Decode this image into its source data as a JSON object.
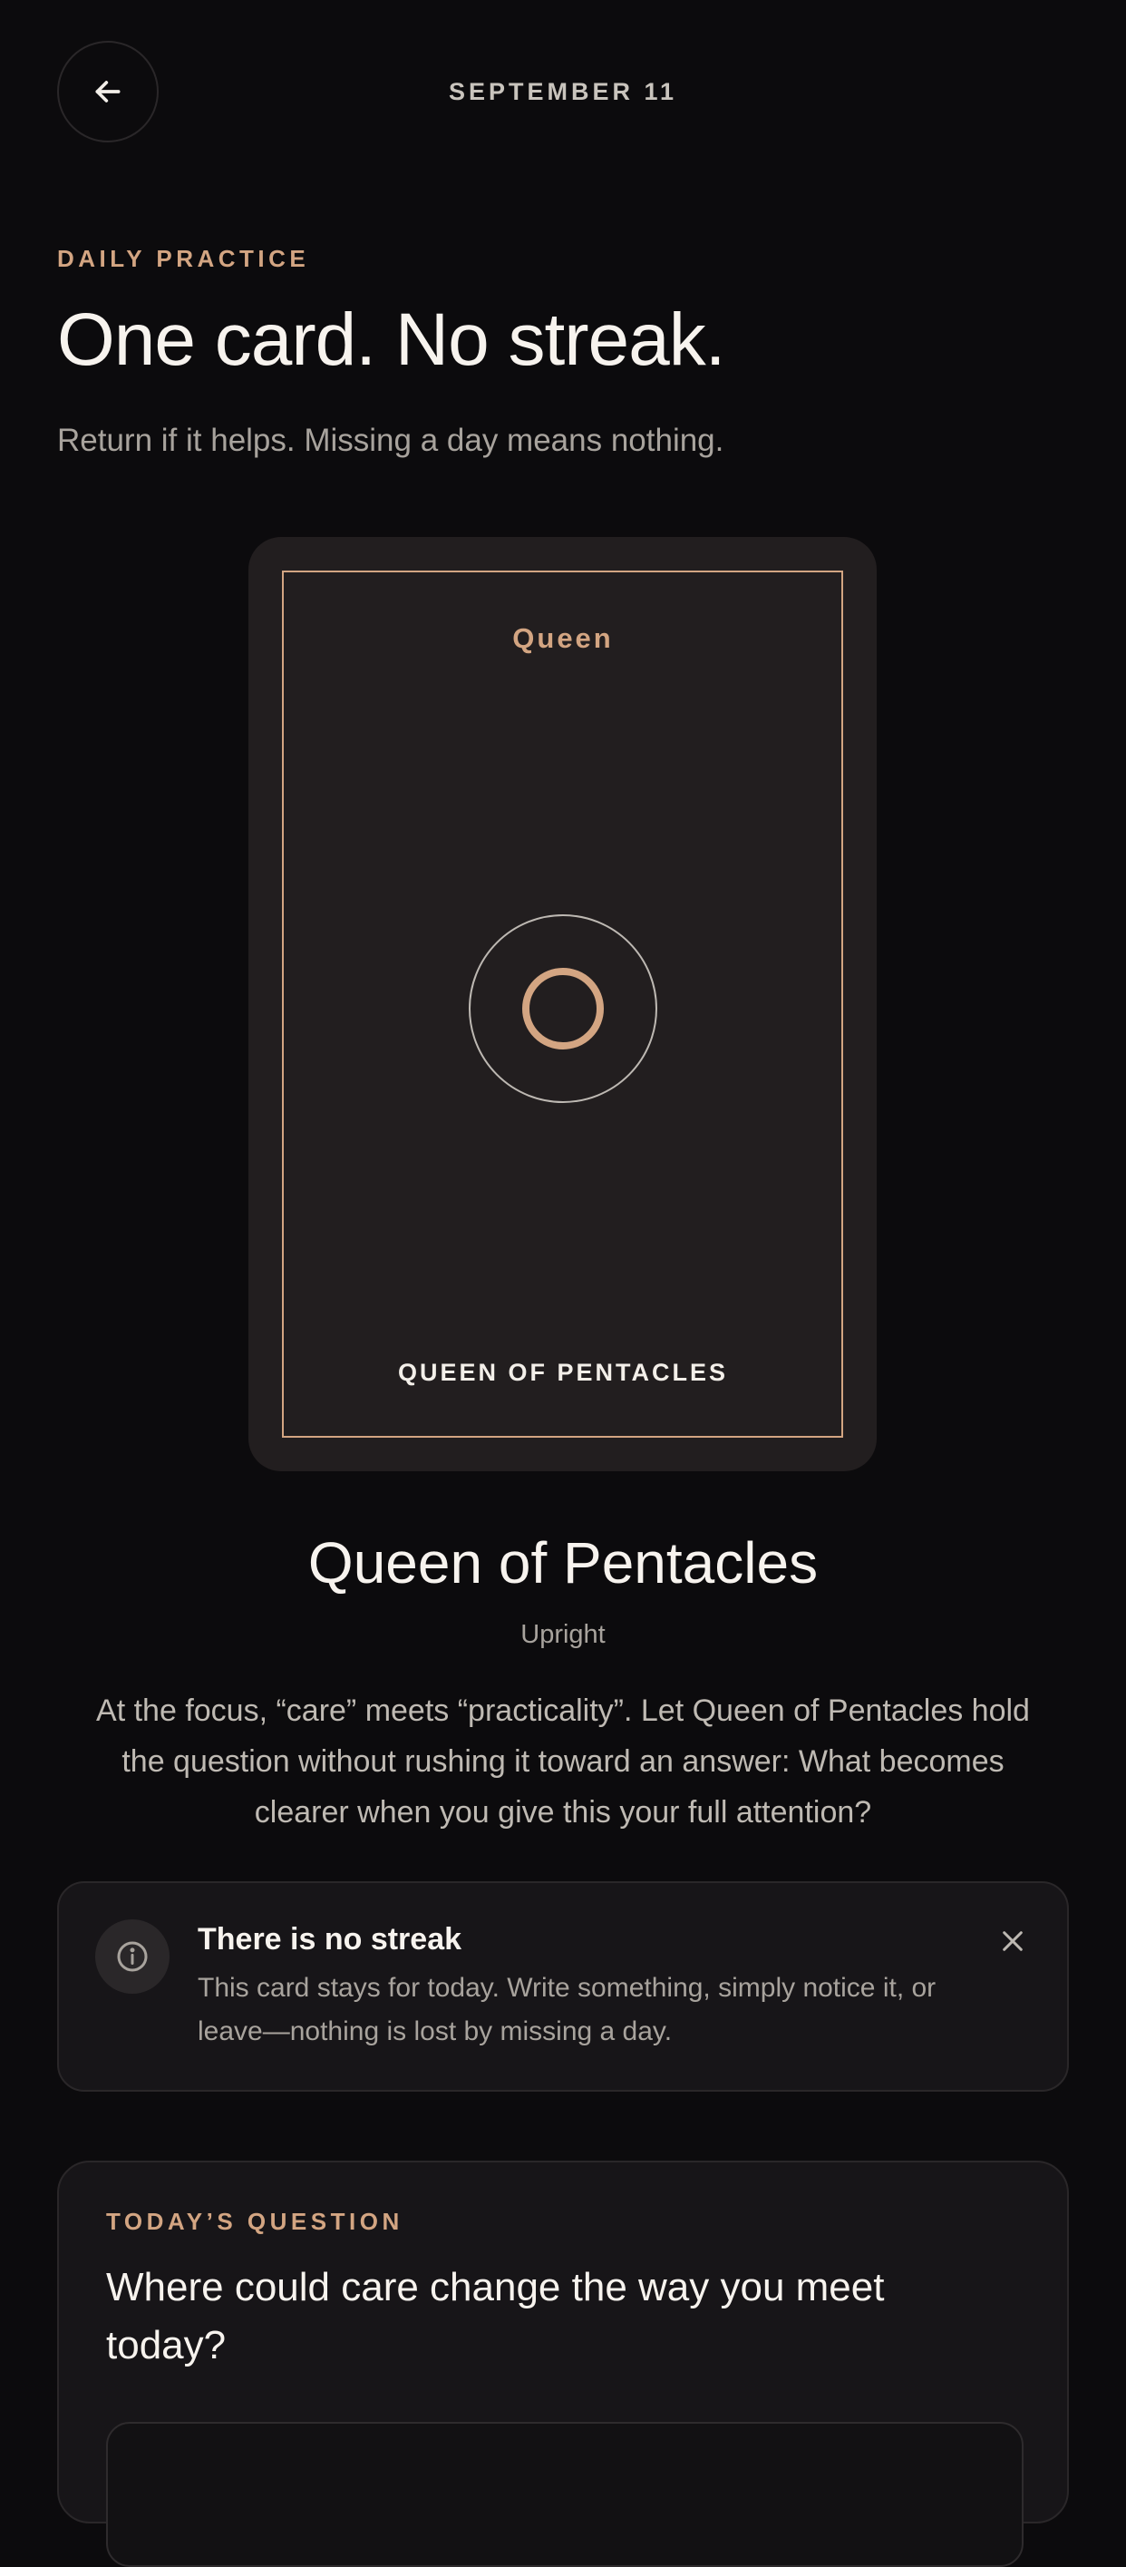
{
  "header": {
    "back_icon": "arrow-left-icon",
    "date": "SEPTEMBER 11"
  },
  "intro": {
    "eyebrow": "DAILY PRACTICE",
    "title": "One card. No streak.",
    "subtitle": "Return if it helps. Missing a day means nothing."
  },
  "card": {
    "rank": "Queen",
    "emblem_icon": "pentacle-ring-icon",
    "caption": "QUEEN OF PENTACLES",
    "title": "Queen of Pentacles",
    "orientation": "Upright",
    "reading": "At the focus, “care” meets “practicality”. Let Queen of Pentacles hold the question without rushing it toward an answer: What becomes clearer when you give this your full attention?"
  },
  "notice": {
    "icon": "info-icon",
    "title": "There is no streak",
    "body": "This card stays for today. Write something, simply notice it, or leave—nothing is lost by missing a day.",
    "close_icon": "close-icon"
  },
  "question": {
    "eyebrow": "TODAY’S QUESTION",
    "text": "Where could care change the way you meet today?"
  },
  "colors": {
    "background": "#0c0b0d",
    "accent": "#d3a582",
    "card_surface": "#221e1f",
    "panel_surface": "#171518"
  }
}
